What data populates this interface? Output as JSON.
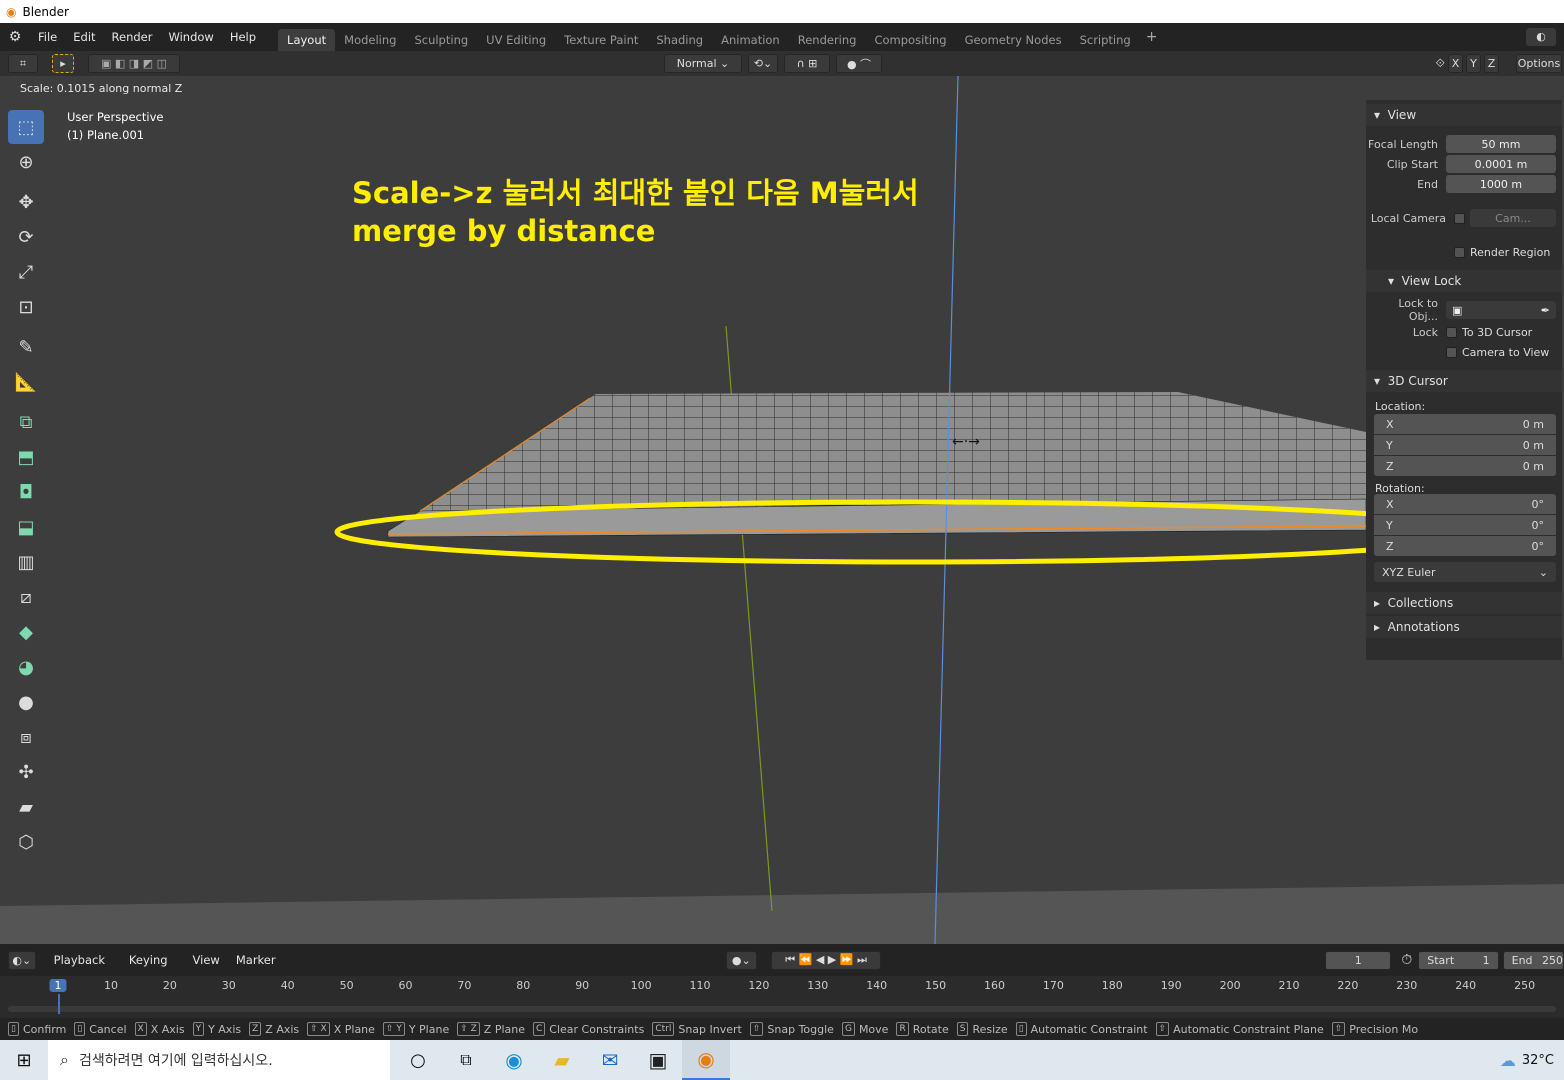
{
  "app": {
    "title": "Blender"
  },
  "menu": [
    "File",
    "Edit",
    "Render",
    "Window",
    "Help"
  ],
  "workspaces": [
    "Layout",
    "Modeling",
    "Sculpting",
    "UV Editing",
    "Texture Paint",
    "Shading",
    "Animation",
    "Rendering",
    "Compositing",
    "Geometry Nodes",
    "Scripting"
  ],
  "header": {
    "orientation": "Normal",
    "axes": [
      "X",
      "Y",
      "Z"
    ],
    "options_label": "Options"
  },
  "operator_status": "Scale: 0.1015 along normal Z",
  "viewport": {
    "perspective": "User Perspective",
    "object": "(1) Plane.001"
  },
  "annotation": {
    "line1": "Scale->z 눌러서 최대한 붙인 다음 M눌러서",
    "line2": "merge by distance",
    "color": "#ffee00"
  },
  "npanel": {
    "view": {
      "title": "View",
      "focal_label": "Focal Length",
      "focal": "50 mm",
      "clip_start_label": "Clip Start",
      "clip_start": "0.0001 m",
      "end_label": "End",
      "end": "1000 m",
      "local_camera_label": "Local Camera",
      "camera_placeholder": "Cam...",
      "render_region": "Render Region"
    },
    "view_lock": {
      "title": "View Lock",
      "lock_obj_label": "Lock to Obj...",
      "lock_label": "Lock",
      "to_cursor": "To 3D Cursor",
      "camera_to_view": "Camera to View"
    },
    "cursor": {
      "title": "3D Cursor",
      "location_label": "Location:",
      "loc": [
        {
          "axis": "X",
          "value": "0 m"
        },
        {
          "axis": "Y",
          "value": "0 m"
        },
        {
          "axis": "Z",
          "value": "0 m"
        }
      ],
      "rotation_label": "Rotation:",
      "rot": [
        {
          "axis": "X",
          "value": "0°"
        },
        {
          "axis": "Y",
          "value": "0°"
        },
        {
          "axis": "Z",
          "value": "0°"
        }
      ],
      "mode": "XYZ Euler"
    },
    "collections": "Collections",
    "annotations": "Annotations"
  },
  "timeline": {
    "playback": "Playback",
    "keying": "Keying",
    "view": "View",
    "marker": "Marker",
    "current": "1",
    "start_label": "Start",
    "start": "1",
    "end_label": "End",
    "end": "250",
    "ticks": [
      "1",
      "10",
      "20",
      "30",
      "40",
      "50",
      "60",
      "70",
      "80",
      "90",
      "100",
      "110",
      "120",
      "130",
      "140",
      "150",
      "160",
      "170",
      "180",
      "190",
      "200",
      "210",
      "220",
      "230",
      "240",
      "250"
    ]
  },
  "status": [
    {
      "key": "",
      "label": "Confirm"
    },
    {
      "key": "",
      "label": "Cancel"
    },
    {
      "key": "X",
      "label": "X Axis"
    },
    {
      "key": "Y",
      "label": "Y Axis"
    },
    {
      "key": "Z",
      "label": "Z Axis"
    },
    {
      "key": "⇧ X",
      "label": "X Plane"
    },
    {
      "key": "⇧ Y",
      "label": "Y Plane"
    },
    {
      "key": "⇧ Z",
      "label": "Z Plane"
    },
    {
      "key": "C",
      "label": "Clear Constraints"
    },
    {
      "key": "Ctrl",
      "label": "Snap Invert"
    },
    {
      "key": "⇧",
      "label": "Snap Toggle"
    },
    {
      "key": "G",
      "label": "Move"
    },
    {
      "key": "R",
      "label": "Rotate"
    },
    {
      "key": "S",
      "label": "Resize"
    },
    {
      "key": "",
      "label": "Automatic Constraint"
    },
    {
      "key": "⇧",
      "label": "Automatic Constraint Plane"
    },
    {
      "key": "⇧",
      "label": "Precision Mo"
    }
  ],
  "taskbar": {
    "search_placeholder": "검색하려면 여기에 입력하십시오.",
    "temperature": "32°C"
  }
}
